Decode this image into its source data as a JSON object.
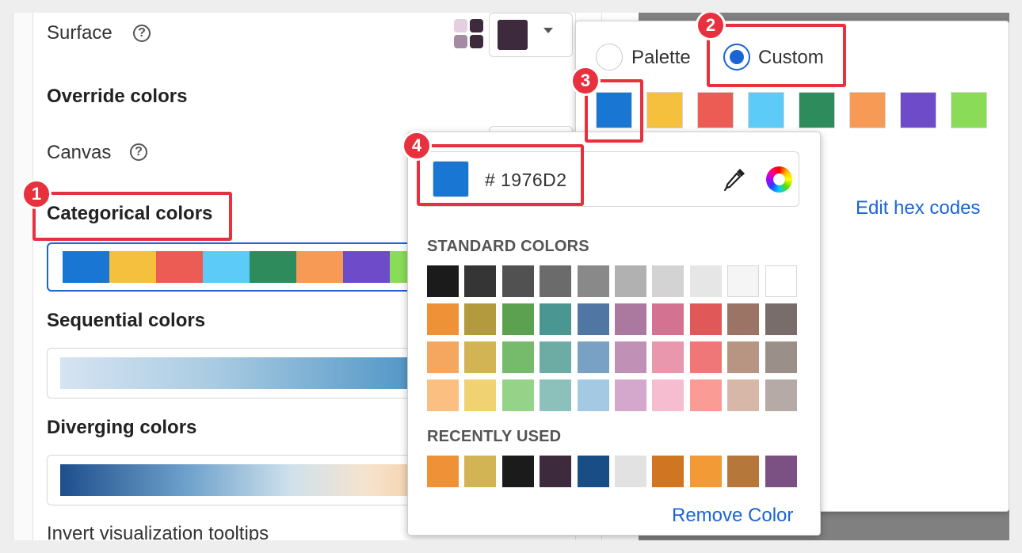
{
  "left": {
    "surface_label": "Surface",
    "surface_color": "#3d2a3c",
    "surface_mini_colors": [
      "#e3cfe0",
      "#3d2a3c",
      "#a48aa3",
      "#3d2a3c"
    ],
    "override_title": "Override colors",
    "canvas_label": "Canvas",
    "categorical_title": "Categorical colors",
    "categorical_colors": [
      "#1976D2",
      "#F4C03E",
      "#EC5C55",
      "#5CCBF7",
      "#2E8B5B",
      "#F79A55",
      "#6E4BC9",
      "#8ADC58"
    ],
    "sequential_title": "Sequential colors",
    "diverging_title": "Diverging colors",
    "invert_label": "Invert visualization tooltips"
  },
  "custom_panel": {
    "palette_label": "Palette",
    "custom_label": "Custom",
    "custom_colors": [
      "#1976D2",
      "#F4C03E",
      "#EC5C55",
      "#5CCBF7",
      "#2E8B5B",
      "#F79A55",
      "#6E4BC9",
      "#8ADC58"
    ],
    "edit_hex_label": "Edit hex codes"
  },
  "picker": {
    "current_color": "#1976D2",
    "hash": "#",
    "hex_value": "1976D2",
    "standard_heading": "STANDARD COLORS",
    "standard_colors": [
      [
        "#1b1b1b",
        "#353535",
        "#515151",
        "#6b6b6b",
        "#898989",
        "#b1b1b1",
        "#d3d3d3",
        "#e6e6e6",
        "#f5f5f5",
        "#ffffff"
      ],
      [
        "#ef9137",
        "#b39a3e",
        "#5ca150",
        "#4a9791",
        "#5077a3",
        "#ab799f",
        "#d47391",
        "#e05858",
        "#9c7465",
        "#786d6a"
      ],
      [
        "#f5a65f",
        "#d3b454",
        "#76bb6c",
        "#6daca5",
        "#78a1c3",
        "#c190b7",
        "#e897ad",
        "#ef7777",
        "#b79582",
        "#9b8f8a"
      ],
      [
        "#fbbf81",
        "#f0d273",
        "#94d388",
        "#8cc1bb",
        "#a3c9e3",
        "#d4a8cc",
        "#f6bdd0",
        "#fb9b96",
        "#d7b8a8",
        "#b6aaa7"
      ]
    ],
    "recent_heading": "RECENTLY USED",
    "recent_colors": [
      "#ef9137",
      "#d3b454",
      "#1b1b1b",
      "#3d2a3c",
      "#184d86",
      "#e2e2e2",
      "#d07623",
      "#f29a36",
      "#b5773a",
      "#7b5083"
    ],
    "remove_label": "Remove Color"
  },
  "badges": [
    "1",
    "2",
    "3",
    "4"
  ]
}
